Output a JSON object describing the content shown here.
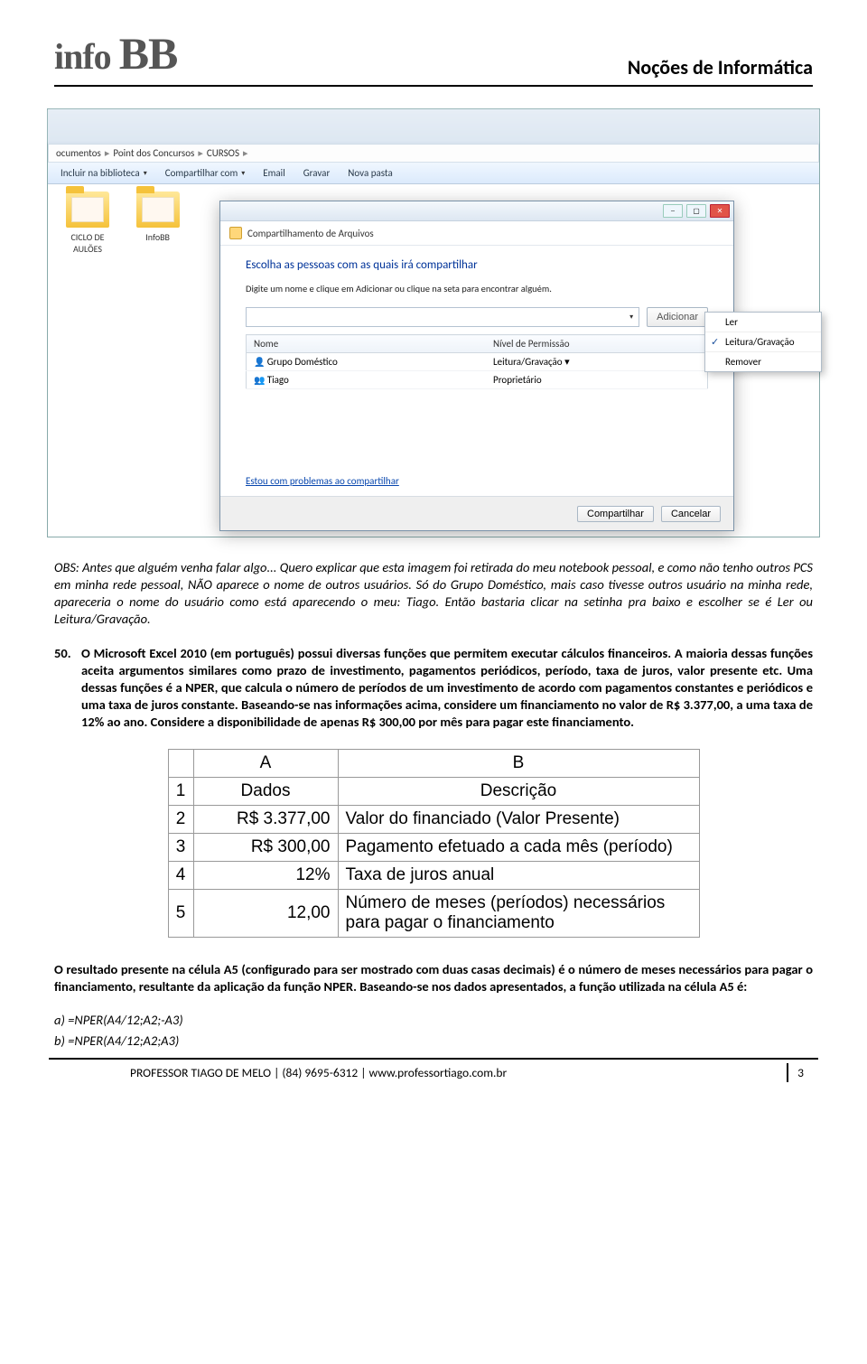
{
  "header": {
    "logo": "info BB",
    "title": "Noções de Informática"
  },
  "screenshot": {
    "breadcrumb": [
      "ocumentos",
      "Point dos Concursos",
      "CURSOS"
    ],
    "toolbar": {
      "include": "Incluir na biblioteca",
      "share": "Compartilhar com",
      "email": "Email",
      "burn": "Gravar",
      "newfolder": "Nova pasta"
    },
    "folders": [
      {
        "name": "CICLO DE AULÕES"
      },
      {
        "name": "InfoBB"
      }
    ],
    "dialog": {
      "title": "Compartilhamento de Arquivos",
      "heading": "Escolha as pessoas com as quais irá compartilhar",
      "hint": "Digite um nome e clique em Adicionar ou clique na seta para encontrar alguém.",
      "add": "Adicionar",
      "col_name": "Nome",
      "col_perm": "Nível de Permissão",
      "rows": [
        {
          "name": "Grupo Doméstico",
          "perm": "Leitura/Gravação ▾"
        },
        {
          "name": "Tiago",
          "perm": "Proprietário"
        }
      ],
      "menu": {
        "read": "Ler",
        "rw": "Leitura/Gravação",
        "remove": "Remover"
      },
      "help": "Estou com problemas ao compartilhar",
      "ok": "Compartilhar",
      "cancel": "Cancelar"
    }
  },
  "obs": "OBS: Antes que alguém venha falar algo... Quero explicar que esta imagem foi retirada do meu notebook pessoal, e como não tenho outros PCS em minha rede pessoal, NÃO aparece o nome de outros usuários. Só do Grupo Doméstico, mais caso tivesse outros usuário na minha rede, apareceria o nome do usuário como está aparecendo o meu: Tiago. Então bastaria clicar na setinha pra baixo e escolher se é Ler ou Leitura/Gravação.",
  "question": {
    "num": "50.",
    "text": "O Microsoft Excel 2010 (em português) possui diversas funções que permitem executar cálculos financeiros. A maioria dessas funções aceita argumentos similares como prazo de investimento, pagamentos periódicos, período, taxa de juros, valor presente etc. Uma dessas funções é a NPER, que calcula o número de períodos de um investimento de acordo com pagamentos constantes e periódicos e uma taxa de juros constante. Baseando-se nas informações acima, considere um financiamento no valor de R$ 3.377,00, a uma taxa de 12% ao ano. Considere a disponibilidade de apenas R$ 300,00 por mês para pagar este financiamento."
  },
  "excel": {
    "hA": "A",
    "hB": "B",
    "r1A": "Dados",
    "r1B": "Descrição",
    "r2A": "R$ 3.377,00",
    "r2B": "Valor do financiado (Valor Presente)",
    "r3A": "R$ 300,00",
    "r3B": "Pagamento efetuado a cada mês (período)",
    "r4A": "12%",
    "r4B": "Taxa de juros anual",
    "r5A": "12,00",
    "r5B": "Número de meses (períodos) necessários para pagar o financiamento"
  },
  "result": "O resultado presente na célula A5 (configurado para ser mostrado com duas casas decimais) é o número de meses necessários para pagar o financiamento, resultante da aplicação da função NPER. Baseando-se nos dados apresentados, a função utilizada na célula A5 é:",
  "options": {
    "a": "a)  =NPER(A4/12;A2;-A3)",
    "b": "b)  =NPER(A4/12;A2;A3)"
  },
  "footer": {
    "text": "PROFESSOR TIAGO DE MELO | (84) 9695-6312 | www.professortiago.com.br",
    "page": "3"
  }
}
